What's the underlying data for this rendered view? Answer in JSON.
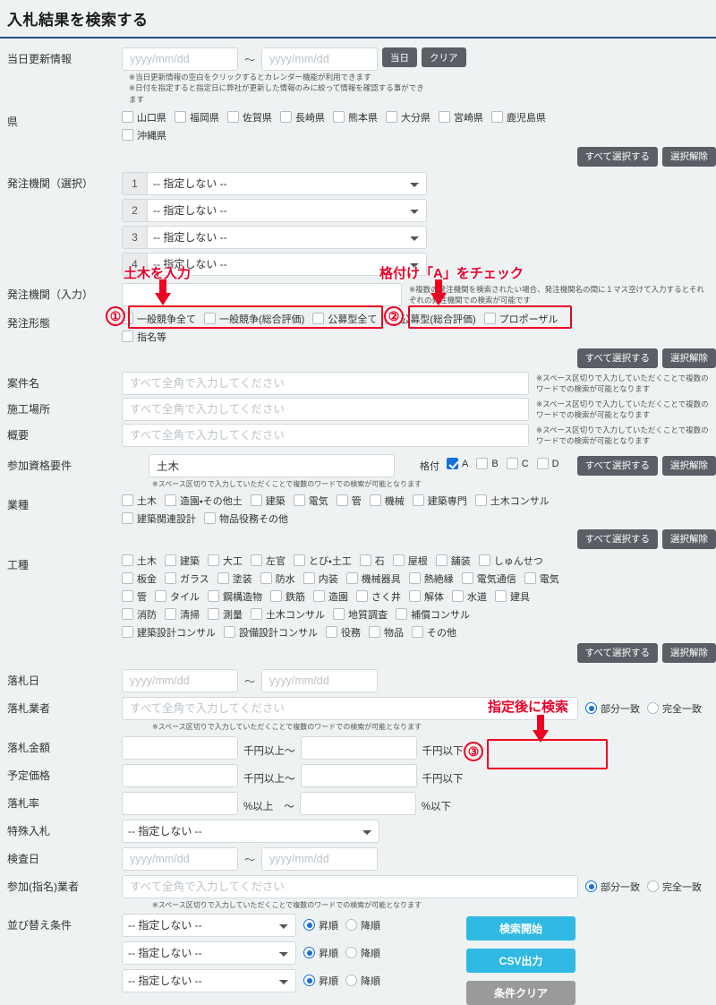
{
  "header": {
    "title": "入札結果を検索する"
  },
  "common": {
    "select_all": "すべて選択する",
    "clear_selection": "選択解除",
    "not_specified": "-- 指定しない --",
    "fullwidth_placeholder": "すべて全角で入力してください",
    "date_placeholder": "yyyy/mm/dd",
    "tilde": "～",
    "space_note": "※スペース区切りで入力していただくことで複数のワードでの検索が可能となります"
  },
  "rows": {
    "update_info": {
      "label": "当日更新情報",
      "from": "",
      "to": "",
      "today_button": "当日",
      "clear_button": "クリア",
      "note": "※当日更新情報の空白をクリックするとカレンダー機能が利用できます\n※日付を指定すると指定日に弊社が更新した情報のみに絞って情報を確認する事ができます"
    },
    "prefecture": {
      "label": "県",
      "items": [
        {
          "label": "山口県",
          "checked": false
        },
        {
          "label": "福岡県",
          "checked": false
        },
        {
          "label": "佐賀県",
          "checked": false
        },
        {
          "label": "長崎県",
          "checked": false
        },
        {
          "label": "熊本県",
          "checked": false
        },
        {
          "label": "大分県",
          "checked": false
        },
        {
          "label": "宮崎県",
          "checked": false
        },
        {
          "label": "鹿児島県",
          "checked": false
        },
        {
          "label": "沖縄県",
          "checked": false
        }
      ]
    },
    "agency_select": {
      "label": "発注機関（選択）",
      "selects": [
        {
          "num": "1",
          "value": "-- 指定しない --"
        },
        {
          "num": "2",
          "value": "-- 指定しない --"
        },
        {
          "num": "3",
          "value": "-- 指定しない --"
        },
        {
          "num": "4",
          "value": "-- 指定しない --"
        }
      ]
    },
    "agency_input": {
      "label": "発注機関（入力）",
      "value": "",
      "note": "※複数の発注機関を検索されたい場合、発注機関名の間に１マス空けて入力するとそれぞれの発注機関での検索が可能です"
    },
    "order_type": {
      "label": "発注形態",
      "items": [
        {
          "label": "一般競争全て",
          "checked": false
        },
        {
          "label": "一般競争(総合評価)",
          "checked": false
        },
        {
          "label": "公募型全て",
          "checked": false
        },
        {
          "label": "公募型(総合評価)",
          "checked": false
        },
        {
          "label": "プロポーザル",
          "checked": false
        },
        {
          "label": "指名等",
          "checked": false
        }
      ]
    },
    "case_name": {
      "label": "案件名",
      "value": ""
    },
    "site": {
      "label": "施工場所",
      "value": ""
    },
    "summary": {
      "label": "概要",
      "value": ""
    },
    "qualification": {
      "label": "参加資格要件",
      "value": "土木",
      "rank_label": "格付",
      "ranks": [
        {
          "label": "A",
          "checked": true
        },
        {
          "label": "B",
          "checked": false
        },
        {
          "label": "C",
          "checked": false
        },
        {
          "label": "D",
          "checked": false
        }
      ]
    },
    "industry": {
      "label": "業種",
      "items": [
        {
          "label": "土木",
          "checked": false
        },
        {
          "label": "造園・その他土",
          "checked": false
        },
        {
          "label": "建築",
          "checked": false
        },
        {
          "label": "電気",
          "checked": false
        },
        {
          "label": "管",
          "checked": false
        },
        {
          "label": "機械",
          "checked": false
        },
        {
          "label": "建築専門",
          "checked": false
        },
        {
          "label": "土木コンサル",
          "checked": false
        },
        {
          "label": "建築関連設計",
          "checked": false
        },
        {
          "label": "物品役務その他",
          "checked": false
        }
      ]
    },
    "work_type": {
      "label": "工種",
      "items": [
        {
          "label": "土木",
          "checked": false
        },
        {
          "label": "建築",
          "checked": false
        },
        {
          "label": "大工",
          "checked": false
        },
        {
          "label": "左官",
          "checked": false
        },
        {
          "label": "とび・土工",
          "checked": false
        },
        {
          "label": "石",
          "checked": false
        },
        {
          "label": "屋根",
          "checked": false
        },
        {
          "label": "舗装",
          "checked": false
        },
        {
          "label": "しゅんせつ",
          "checked": false
        },
        {
          "label": "板金",
          "checked": false
        },
        {
          "label": "ガラス",
          "checked": false
        },
        {
          "label": "塗装",
          "checked": false
        },
        {
          "label": "防水",
          "checked": false
        },
        {
          "label": "内装",
          "checked": false
        },
        {
          "label": "機械器具",
          "checked": false
        },
        {
          "label": "熱絶縁",
          "checked": false
        },
        {
          "label": "電気通信",
          "checked": false
        },
        {
          "label": "電気",
          "checked": false
        },
        {
          "label": "管",
          "checked": false
        },
        {
          "label": "タイル",
          "checked": false
        },
        {
          "label": "鋼構造物",
          "checked": false
        },
        {
          "label": "鉄筋",
          "checked": false
        },
        {
          "label": "造園",
          "checked": false
        },
        {
          "label": "さく井",
          "checked": false
        },
        {
          "label": "解体",
          "checked": false
        },
        {
          "label": "水道",
          "checked": false
        },
        {
          "label": "建具",
          "checked": false
        },
        {
          "label": "消防",
          "checked": false
        },
        {
          "label": "清掃",
          "checked": false
        },
        {
          "label": "測量",
          "checked": false
        },
        {
          "label": "土木コンサル",
          "checked": false
        },
        {
          "label": "地質調査",
          "checked": false
        },
        {
          "label": "補償コンサル",
          "checked": false
        },
        {
          "label": "建築設計コンサル",
          "checked": false
        },
        {
          "label": "設備設計コンサル",
          "checked": false
        },
        {
          "label": "役務",
          "checked": false
        },
        {
          "label": "物品",
          "checked": false
        },
        {
          "label": "その他",
          "checked": false
        }
      ]
    },
    "award_date": {
      "label": "落札日",
      "from": "",
      "to": ""
    },
    "awardee": {
      "label": "落札業者",
      "value": "",
      "match_partial": "部分一致",
      "match_exact": "完全一致",
      "match_selected": "部分一致"
    },
    "award_amount": {
      "label": "落札金額",
      "from": "",
      "to": "",
      "unit_from": "千円以上～",
      "unit_to": "千円以下"
    },
    "planned_price": {
      "label": "予定価格",
      "from": "",
      "to": "",
      "unit_from": "千円以上～",
      "unit_to": "千円以下"
    },
    "award_rate": {
      "label": "落札率",
      "from": "",
      "to": "",
      "unit_from": "%以上",
      "tilde": "～",
      "unit_to": "%以下"
    },
    "special_bid": {
      "label": "特殊入札",
      "value": "-- 指定しない --"
    },
    "inspection_date": {
      "label": "検査日",
      "from": "",
      "to": ""
    },
    "participant": {
      "label": "参加(指名)業者",
      "value": "",
      "match_partial": "部分一致",
      "match_exact": "完全一致",
      "match_selected": "部分一致"
    },
    "sort": {
      "label": "並び替え条件",
      "asc": "昇順",
      "desc": "降順",
      "items": [
        {
          "value": "-- 指定しない --",
          "order": "昇順"
        },
        {
          "value": "-- 指定しない --",
          "order": "昇順"
        },
        {
          "value": "-- 指定しない --",
          "order": "昇順"
        }
      ]
    }
  },
  "actions": {
    "search": "検索開始",
    "csv": "CSV出力",
    "clear": "条件クリア"
  },
  "annotations": [
    {
      "id": "1",
      "marker": "①",
      "text": "土木を入力"
    },
    {
      "id": "2",
      "marker": "②",
      "text": "格付け「A」をチェック"
    },
    {
      "id": "3",
      "marker": "③",
      "text": "指定後に検索"
    }
  ],
  "colors": {
    "accent_blue": "#2a4c86",
    "button_cyan": "#2fb9e3",
    "button_gray": "#9a9a9a",
    "button_dark": "#5a5f66",
    "annotation_red": "#ee0022",
    "checkbox_checked": "#1570d8"
  }
}
